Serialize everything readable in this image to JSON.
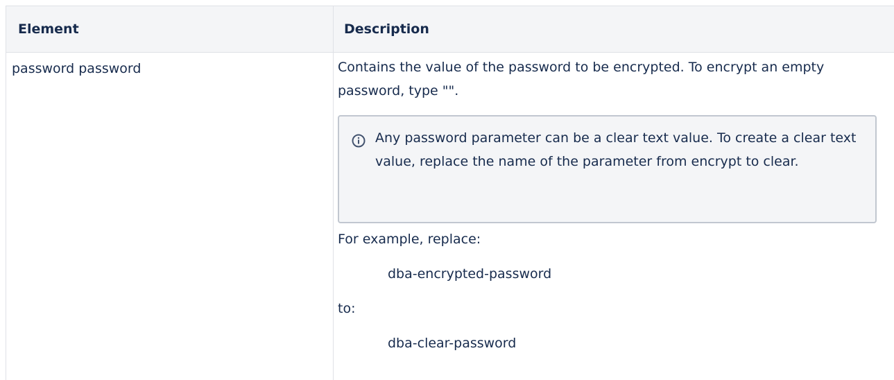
{
  "table": {
    "headers": {
      "element": "Element",
      "description": "Description"
    },
    "rows": [
      {
        "element": "password password",
        "description": {
          "intro": "Contains the value of the password to be encrypted. To encrypt an empty password, type \"\".",
          "info_panel": {
            "icon": "info-icon",
            "text": "Any password parameter can be a clear text value. To create a clear text value, replace the name of the parameter from encrypt to clear."
          },
          "example_label": "For example, replace:",
          "example_from": "dba-encrypted-password",
          "to_label": "to:",
          "example_to": "dba-clear-password"
        }
      }
    ]
  },
  "colors": {
    "header_bg": "#f4f5f7",
    "border": "#dfe1e6",
    "panel_border": "#c1c7d0",
    "text": "#172b4d"
  }
}
